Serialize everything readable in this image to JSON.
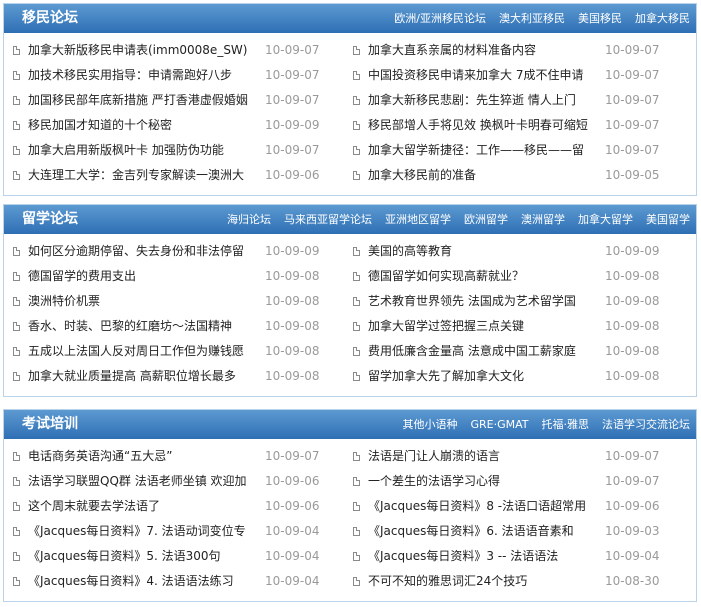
{
  "sections": [
    {
      "title": "移民论坛",
      "links": [
        "欧洲/亚洲移民论坛",
        "澳大利亚移民",
        "美国移民",
        "加拿大移民"
      ],
      "left": [
        {
          "title": "加拿大新版移民申请表(imm0008e_SW)",
          "date": "10-09-07"
        },
        {
          "title": "加技术移民实用指导：申请需跑好八步",
          "date": "10-09-07"
        },
        {
          "title": "加国移民部年底新措施 严打香港虚假婚姻",
          "date": "10-09-07"
        },
        {
          "title": "移民加国才知道的十个秘密",
          "date": "10-09-09"
        },
        {
          "title": "加拿大启用新版枫叶卡 加强防伪功能",
          "date": "10-09-07"
        },
        {
          "title": "大连理工大学：金吉列专家解读一澳洲大",
          "date": "10-09-06"
        }
      ],
      "right": [
        {
          "title": "加拿大直系亲属的材料准备内容",
          "date": "10-09-07"
        },
        {
          "title": "中国投资移民申请来加拿大 7成不住申请",
          "date": "10-09-07"
        },
        {
          "title": "加拿大新移民悲剧：先生猝逝 情人上门",
          "date": "10-09-07"
        },
        {
          "title": "移民部增人手将见效 换枫叶卡明春可缩短",
          "date": "10-09-07"
        },
        {
          "title": "加拿大留学新捷径：工作——移民——留",
          "date": "10-09-07"
        },
        {
          "title": "加拿大移民前的准备",
          "date": "10-09-05"
        }
      ]
    },
    {
      "title": "留学论坛",
      "links": [
        "海归论坛",
        "马来西亚留学论坛",
        "亚洲地区留学",
        "欧洲留学",
        "澳洲留学",
        "加拿大留学",
        "美国留学"
      ],
      "left": [
        {
          "title": "如何区分逾期停留、失去身份和非法停留",
          "date": "10-09-09"
        },
        {
          "title": "德国留学的费用支出",
          "date": "10-09-08"
        },
        {
          "title": "澳洲特价机票",
          "date": "10-09-08"
        },
        {
          "title": "香水、时装、巴黎的红磨坊～法国精神",
          "date": "10-09-08"
        },
        {
          "title": "五成以上法国人反对周日工作但为赚钱愿",
          "date": "10-09-08"
        },
        {
          "title": "加拿大就业质量提高 高薪职位增长最多",
          "date": "10-09-08"
        }
      ],
      "right": [
        {
          "title": "美国的高等教育",
          "date": "10-09-09"
        },
        {
          "title": "德国留学如何实现高薪就业？",
          "date": "10-09-08"
        },
        {
          "title": "艺术教育世界领先 法国成为艺术留学国",
          "date": "10-09-08"
        },
        {
          "title": "加拿大留学过签把握三点关键",
          "date": "10-09-08"
        },
        {
          "title": "费用低廉含金量高 法意成中国工薪家庭",
          "date": "10-09-08"
        },
        {
          "title": "留学加拿大先了解加拿大文化",
          "date": "10-09-08"
        }
      ]
    },
    {
      "title": "考试培训",
      "links": [
        "其他小语种",
        "GRE·GMAT",
        "托福·雅思",
        "法语学习交流论坛"
      ],
      "left": [
        {
          "title": "电话商务英语沟通“五大忌”",
          "date": "10-09-07"
        },
        {
          "title": "法语学习联盟QQ群 法语老师坐镇 欢迎加",
          "date": "10-09-06"
        },
        {
          "title": "这个周末就要去学法语了",
          "date": "10-09-06"
        },
        {
          "title": "《Jacques每日资料》7. 法语动词变位专",
          "date": "10-09-04"
        },
        {
          "title": "《Jacques每日资料》5. 法语300句",
          "date": "10-09-04"
        },
        {
          "title": "《Jacques每日资料》4. 法语语法练习",
          "date": "10-09-04"
        }
      ],
      "right": [
        {
          "title": "法语是门让人崩溃的语言",
          "date": "10-09-07"
        },
        {
          "title": "一个差生的法语学习心得",
          "date": "10-09-07"
        },
        {
          "title": "《Jacques每日资料》8 -法语口语超常用",
          "date": "10-09-06"
        },
        {
          "title": "《Jacques每日资料》6. 法语语音素和",
          "date": "10-09-03"
        },
        {
          "title": "《Jacques每日资料》3 -- 法语语法",
          "date": "10-09-04"
        },
        {
          "title": "不可不知的雅思词汇24个技巧",
          "date": "10-08-30"
        }
      ]
    }
  ]
}
